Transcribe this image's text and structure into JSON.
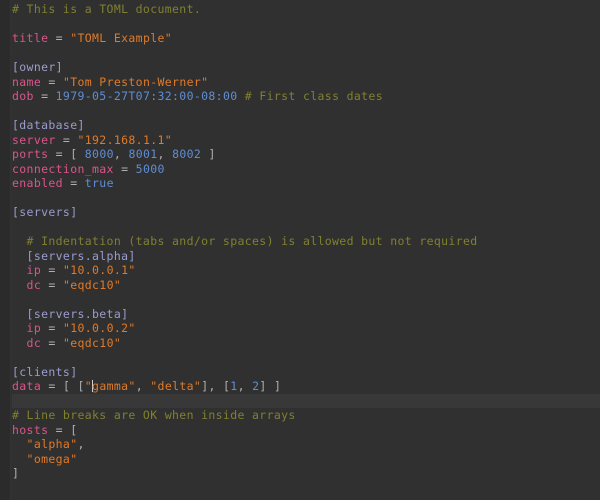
{
  "editor": {
    "language": "TOML",
    "background_color": "#303030",
    "gutter_color": "#2b2b2b",
    "caret_line_color": "#383838",
    "caret_line_index": 27,
    "colors": {
      "comment": "#808030",
      "key": "#d9558a",
      "string": "#e07a28",
      "number": "#5f8dd3",
      "boolean": "#5f8dd3",
      "section": "#9a9ccd",
      "operator": "#b0b0b0"
    },
    "lines": [
      {
        "tokens": [
          {
            "t": "comment",
            "v": "# This is a TOML document."
          }
        ]
      },
      {
        "tokens": []
      },
      {
        "tokens": [
          {
            "t": "key",
            "v": "title"
          },
          {
            "t": "op",
            "v": " = "
          },
          {
            "t": "string",
            "v": "\"TOML Example\""
          }
        ]
      },
      {
        "tokens": []
      },
      {
        "tokens": [
          {
            "t": "section",
            "v": "[owner]"
          }
        ]
      },
      {
        "tokens": [
          {
            "t": "key",
            "v": "name"
          },
          {
            "t": "op",
            "v": " = "
          },
          {
            "t": "string",
            "v": "\"Tom Preston-Werner\""
          }
        ]
      },
      {
        "tokens": [
          {
            "t": "key",
            "v": "dob"
          },
          {
            "t": "op",
            "v": " = "
          },
          {
            "t": "number",
            "v": "1979-05-27T07:32:00-08:00"
          },
          {
            "t": "plain",
            "v": " "
          },
          {
            "t": "comment",
            "v": "# First class dates"
          }
        ]
      },
      {
        "tokens": []
      },
      {
        "tokens": [
          {
            "t": "section",
            "v": "[database]"
          }
        ]
      },
      {
        "tokens": [
          {
            "t": "key",
            "v": "server"
          },
          {
            "t": "op",
            "v": " = "
          },
          {
            "t": "string",
            "v": "\"192.168.1.1\""
          }
        ]
      },
      {
        "tokens": [
          {
            "t": "key",
            "v": "ports"
          },
          {
            "t": "op",
            "v": " = "
          },
          {
            "t": "punct",
            "v": "[ "
          },
          {
            "t": "number",
            "v": "8000"
          },
          {
            "t": "punct",
            "v": ", "
          },
          {
            "t": "number",
            "v": "8001"
          },
          {
            "t": "punct",
            "v": ", "
          },
          {
            "t": "number",
            "v": "8002"
          },
          {
            "t": "punct",
            "v": " ]"
          }
        ]
      },
      {
        "tokens": [
          {
            "t": "key",
            "v": "connection_max"
          },
          {
            "t": "op",
            "v": " = "
          },
          {
            "t": "number",
            "v": "5000"
          }
        ]
      },
      {
        "tokens": [
          {
            "t": "key",
            "v": "enabled"
          },
          {
            "t": "op",
            "v": " = "
          },
          {
            "t": "bool",
            "v": "true"
          }
        ]
      },
      {
        "tokens": []
      },
      {
        "tokens": [
          {
            "t": "section",
            "v": "[servers]"
          }
        ]
      },
      {
        "tokens": []
      },
      {
        "tokens": [
          {
            "t": "comment",
            "v": "  # Indentation (tabs and/or spaces) is allowed but not required"
          }
        ]
      },
      {
        "tokens": [
          {
            "t": "section",
            "v": "  [servers.alpha]"
          }
        ]
      },
      {
        "tokens": [
          {
            "t": "key",
            "v": "  ip"
          },
          {
            "t": "op",
            "v": " = "
          },
          {
            "t": "string",
            "v": "\"10.0.0.1\""
          }
        ]
      },
      {
        "tokens": [
          {
            "t": "key",
            "v": "  dc"
          },
          {
            "t": "op",
            "v": " = "
          },
          {
            "t": "string",
            "v": "\"eqdc10\""
          }
        ]
      },
      {
        "tokens": []
      },
      {
        "tokens": [
          {
            "t": "section",
            "v": "  [servers.beta]"
          }
        ]
      },
      {
        "tokens": [
          {
            "t": "key",
            "v": "  ip"
          },
          {
            "t": "op",
            "v": " = "
          },
          {
            "t": "string",
            "v": "\"10.0.0.2\""
          }
        ]
      },
      {
        "tokens": [
          {
            "t": "key",
            "v": "  dc"
          },
          {
            "t": "op",
            "v": " = "
          },
          {
            "t": "string",
            "v": "\"eqdc10\""
          }
        ]
      },
      {
        "tokens": []
      },
      {
        "tokens": [
          {
            "t": "section",
            "v": "[clients]"
          }
        ]
      },
      {
        "tokens": [
          {
            "t": "key",
            "v": "data"
          },
          {
            "t": "op",
            "v": " = "
          },
          {
            "t": "punct",
            "v": "[ ["
          },
          {
            "t": "string",
            "v": "\""
          },
          {
            "t": "caret",
            "v": ""
          },
          {
            "t": "string",
            "v": "gamma\""
          },
          {
            "t": "punct",
            "v": ", "
          },
          {
            "t": "string",
            "v": "\"delta\""
          },
          {
            "t": "punct",
            "v": "], ["
          },
          {
            "t": "number",
            "v": "1"
          },
          {
            "t": "punct",
            "v": ", "
          },
          {
            "t": "number",
            "v": "2"
          },
          {
            "t": "punct",
            "v": "] ]"
          }
        ]
      },
      {
        "tokens": []
      },
      {
        "tokens": [
          {
            "t": "comment",
            "v": "# Line breaks are OK when inside arrays"
          }
        ]
      },
      {
        "tokens": [
          {
            "t": "key",
            "v": "hosts"
          },
          {
            "t": "op",
            "v": " = "
          },
          {
            "t": "punct",
            "v": "["
          }
        ]
      },
      {
        "tokens": [
          {
            "t": "string",
            "v": "  \"alpha\""
          },
          {
            "t": "punct",
            "v": ","
          }
        ]
      },
      {
        "tokens": [
          {
            "t": "string",
            "v": "  \"omega\""
          }
        ]
      },
      {
        "tokens": [
          {
            "t": "punct",
            "v": "]"
          }
        ]
      }
    ]
  }
}
